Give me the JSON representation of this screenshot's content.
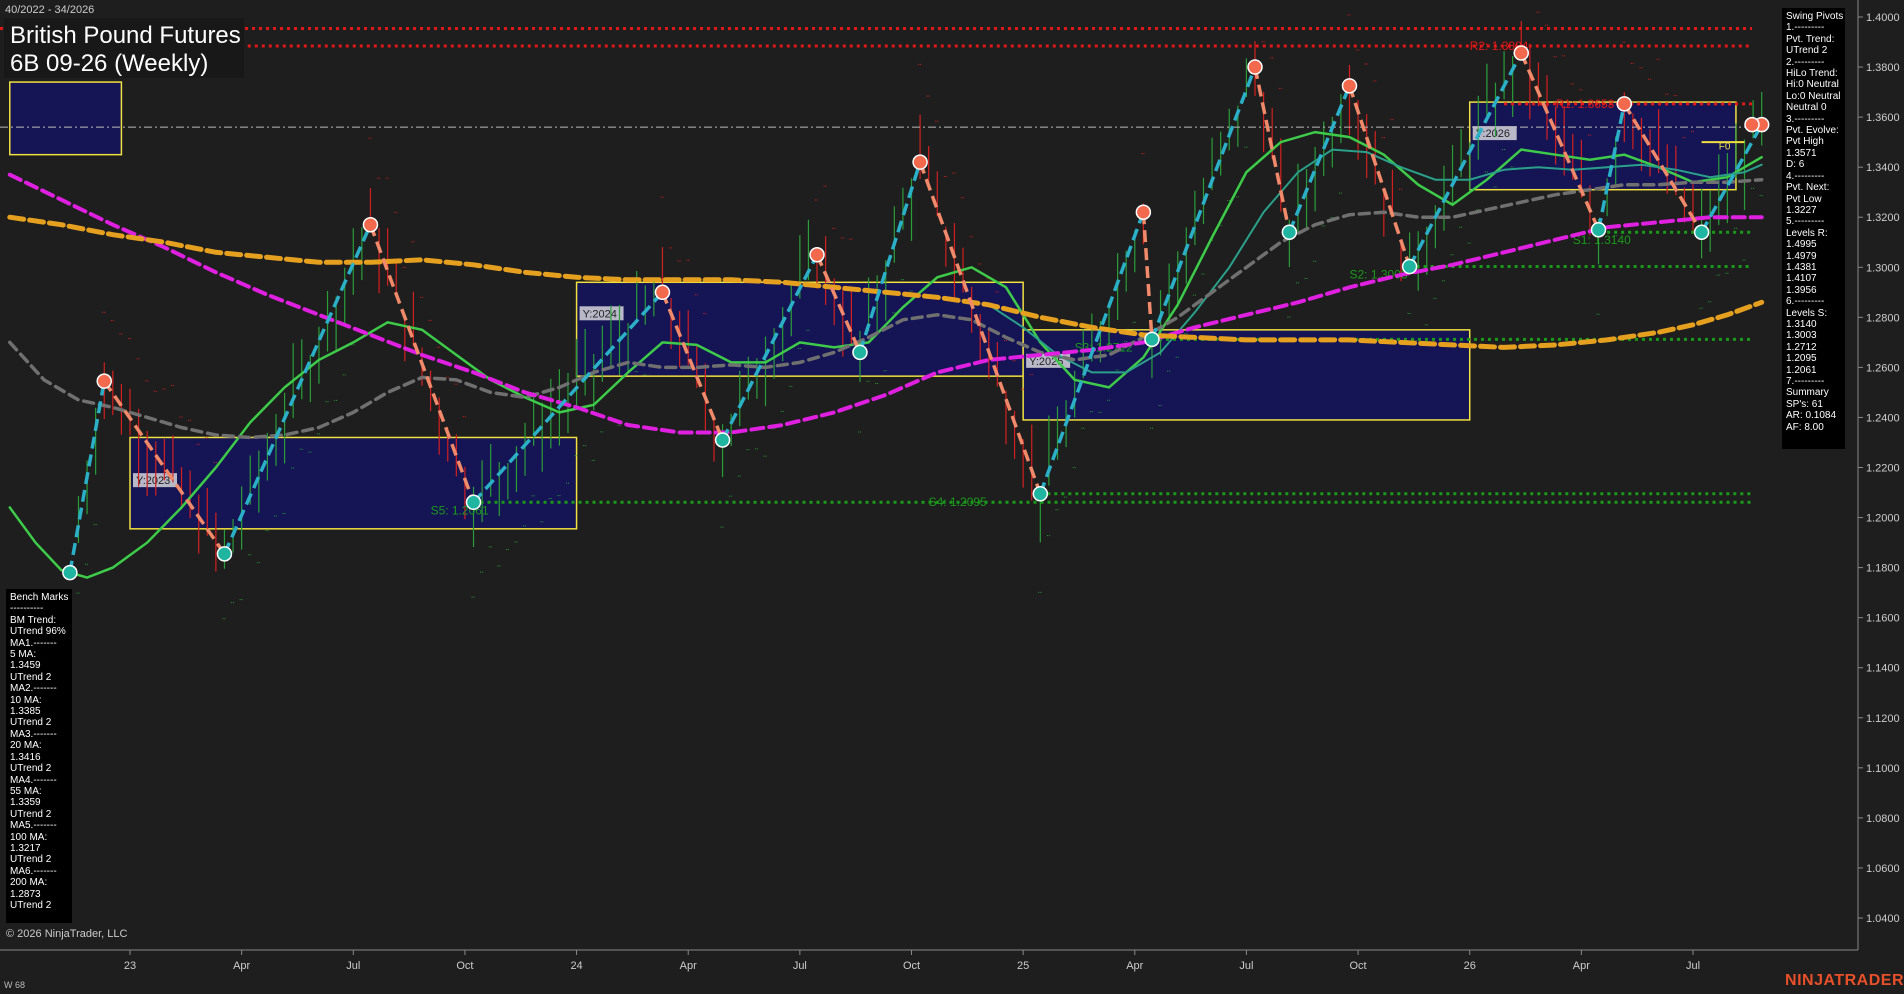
{
  "header": {
    "range": "40/2022 - 34/2026",
    "title": "British Pound Futures",
    "subtitle": "6B 09-26 (Weekly)"
  },
  "footer": {
    "copyright": "© 2026 NinjaTrader, LLC",
    "w_label": "W 68",
    "brand": "NINJATRADER"
  },
  "swing_pivots_panel": [
    "Swing Pivots",
    "1.---------",
    "Pvt. Trend:",
    "UTrend 2",
    "2.---------",
    "HiLo Trend:",
    "Hi:0 Neutral",
    "Lo:0 Neutral",
    "Neutral 0",
    "3.---------",
    "Pvt. Evolve:",
    "Pvt High",
    "1.3571",
    "D: 6",
    "4.---------",
    "Pvt. Next:",
    "Pvt Low",
    "1.3227",
    "5.---------",
    "Levels R:",
    "1.4995",
    "1.4979",
    "1.4381",
    "1.4107",
    "1.3956",
    "6.---------",
    "Levels S:",
    "1.3140",
    "1.3003",
    "1.2712",
    "1.2095",
    "1.2061",
    "7.---------",
    "Summary",
    "SP's: 61",
    "AR: 0.1084",
    "AF: 8.00"
  ],
  "bench_marks_panel": [
    "Bench Marks",
    "----------",
    "BM Trend:",
    "UTrend 96%",
    "MA1.-------",
    "5 MA:",
    "1.3459",
    "UTrend 2",
    "MA2.-------",
    "10 MA:",
    "1.3385",
    "UTrend 2",
    "MA3.-------",
    "20 MA:",
    "1.3416",
    "UTrend 2",
    "MA4.-------",
    "55 MA:",
    "1.3359",
    "UTrend 2",
    "MA5.-------",
    "100 MA:",
    "1.3217",
    "UTrend 2",
    "MA6.-------",
    "200 MA:",
    "1.2873",
    "UTrend 2"
  ],
  "chart_data": {
    "type": "line",
    "ylim": [
      1.03,
      1.405
    ],
    "y_ticks": [
      "1.4000",
      "1.3800",
      "1.3600",
      "1.3400",
      "1.3200",
      "1.3000",
      "1.2800",
      "1.2600",
      "1.2400",
      "1.2200",
      "1.2000",
      "1.1800",
      "1.1600",
      "1.1400",
      "1.1200",
      "1.1000",
      "1.0800",
      "1.0600",
      "1.0400"
    ],
    "x_ticks": [
      "23",
      "Apr",
      "Jul",
      "Oct",
      "24",
      "Apr",
      "Jul",
      "Oct",
      "25",
      "Apr",
      "Jul",
      "Oct",
      "26",
      "Apr",
      "Jul"
    ],
    "x_tick_index": [
      0,
      13,
      26,
      39,
      52,
      65,
      78,
      91,
      104,
      117,
      130,
      143,
      156,
      169,
      182
    ],
    "x_range_index": [
      -14,
      198
    ],
    "colors": {
      "up": "#2a9d3a",
      "down": "#d22020",
      "pivot_up": "#2bb0c8",
      "pivot_down": "#f08a6a",
      "ma_green": "#3ecb4a",
      "ma_teal": "#2aa08a",
      "ma_gray": "#707070",
      "ma_magenta": "#e020e0",
      "ma_orange": "#e6a020",
      "box_border": "#f0e040",
      "box_fill": "#15155a",
      "resistance": "#e01818",
      "support": "#1a9a1a"
    },
    "swing_pivots": [
      {
        "i": -7,
        "v": 1.178,
        "t": "L"
      },
      {
        "i": -3,
        "v": 1.2545,
        "t": "H"
      },
      {
        "i": 11,
        "v": 1.1855,
        "t": "L"
      },
      {
        "i": 28,
        "v": 1.317,
        "t": "H"
      },
      {
        "i": 40,
        "v": 1.2061,
        "t": "L"
      },
      {
        "i": 62,
        "v": 1.29,
        "t": "H"
      },
      {
        "i": 69,
        "v": 1.231,
        "t": "L"
      },
      {
        "i": 80,
        "v": 1.305,
        "t": "H"
      },
      {
        "i": 85,
        "v": 1.266,
        "t": "L"
      },
      {
        "i": 92,
        "v": 1.342,
        "t": "H"
      },
      {
        "i": 106,
        "v": 1.2095,
        "t": "L"
      },
      {
        "i": 118,
        "v": 1.322,
        "t": "H"
      },
      {
        "i": 119,
        "v": 1.2712,
        "t": "L"
      },
      {
        "i": 131,
        "v": 1.38,
        "t": "H"
      },
      {
        "i": 135,
        "v": 1.314,
        "t": "L"
      },
      {
        "i": 142,
        "v": 1.3725,
        "t": "H"
      },
      {
        "i": 149,
        "v": 1.3003,
        "t": "L"
      },
      {
        "i": 162,
        "v": 1.3856,
        "t": "H"
      },
      {
        "i": 171,
        "v": 1.315,
        "t": "L"
      },
      {
        "i": 174,
        "v": 1.3653,
        "t": "H"
      },
      {
        "i": 183,
        "v": 1.314,
        "t": "L"
      },
      {
        "i": 190,
        "v": 1.357,
        "t": "H"
      }
    ],
    "year_boxes": [
      {
        "label": "Y:2023",
        "i0": 0,
        "i1": 52,
        "hi": 1.232,
        "lo": 1.1955
      },
      {
        "label": "Y:2024",
        "i0": 52,
        "i1": 104,
        "hi": 1.294,
        "lo": 1.2565
      },
      {
        "label": "Y:2025",
        "i0": 104,
        "i1": 156,
        "hi": 1.275,
        "lo": 1.239
      },
      {
        "label": "Y:2026",
        "i0": 156,
        "i1": 187,
        "hi": 1.366,
        "lo": 1.331
      },
      {
        "label": "",
        "i0": -14,
        "i1": -1,
        "hi": 1.374,
        "lo": 1.345
      }
    ],
    "levels": [
      {
        "label": "R2: 1.3884",
        "v": 1.3884,
        "kind": "resistance",
        "i0": -14,
        "i_label": 156
      },
      {
        "label": "R1: 1.3653",
        "v": 1.3653,
        "kind": "resistance",
        "i0": 160,
        "i_label": 166
      },
      {
        "label": "S1: 1.3140",
        "v": 1.314,
        "kind": "support",
        "i0": 172,
        "i_label": 168
      },
      {
        "label": "S2: 1.3003",
        "v": 1.3003,
        "kind": "support",
        "i0": 149,
        "i_label": 142
      },
      {
        "label": "S3: 1.2712",
        "v": 1.2712,
        "kind": "support",
        "i0": 119,
        "i_label": 110
      },
      {
        "label": "S4: 1.2095",
        "v": 1.2095,
        "kind": "support",
        "i0": 106,
        "i_label": 93
      },
      {
        "label": "S5: 1.2061",
        "v": 1.2061,
        "kind": "support",
        "i0": 40,
        "i_label": 35
      }
    ],
    "extra_lines": [
      {
        "v": 1.3954,
        "kind": "resistance"
      },
      {
        "v": 1.356,
        "kind": "white_dashdot"
      }
    ],
    "moving_averages": [
      {
        "name": "MA1",
        "color": "ma_green",
        "width": 2.5,
        "dash": "",
        "points": [
          [
            -14,
            1.204
          ],
          [
            -11,
            1.19
          ],
          [
            -8,
            1.179
          ],
          [
            -5,
            1.176
          ],
          [
            -2,
            1.18
          ],
          [
            2,
            1.19
          ],
          [
            6,
            1.204
          ],
          [
            10,
            1.22
          ],
          [
            14,
            1.238
          ],
          [
            18,
            1.252
          ],
          [
            22,
            1.263
          ],
          [
            26,
            1.27
          ],
          [
            30,
            1.278
          ],
          [
            34,
            1.275
          ],
          [
            38,
            1.265
          ],
          [
            42,
            1.255
          ],
          [
            46,
            1.248
          ],
          [
            50,
            1.242
          ],
          [
            54,
            1.245
          ],
          [
            58,
            1.258
          ],
          [
            62,
            1.27
          ],
          [
            66,
            1.269
          ],
          [
            70,
            1.262
          ],
          [
            74,
            1.262
          ],
          [
            78,
            1.27
          ],
          [
            82,
            1.268
          ],
          [
            86,
            1.27
          ],
          [
            90,
            1.284
          ],
          [
            94,
            1.296
          ],
          [
            98,
            1.3
          ],
          [
            102,
            1.292
          ],
          [
            106,
            1.27
          ],
          [
            110,
            1.255
          ],
          [
            114,
            1.252
          ],
          [
            118,
            1.264
          ],
          [
            122,
            1.285
          ],
          [
            126,
            1.312
          ],
          [
            130,
            1.338
          ],
          [
            134,
            1.35
          ],
          [
            138,
            1.354
          ],
          [
            142,
            1.352
          ],
          [
            146,
            1.345
          ],
          [
            150,
            1.333
          ],
          [
            154,
            1.325
          ],
          [
            158,
            1.335
          ],
          [
            162,
            1.347
          ],
          [
            166,
            1.345
          ],
          [
            170,
            1.343
          ],
          [
            174,
            1.345
          ],
          [
            178,
            1.34
          ],
          [
            182,
            1.334
          ],
          [
            186,
            1.336
          ],
          [
            190,
            1.344
          ]
        ]
      },
      {
        "name": "MA2",
        "color": "ma_teal",
        "width": 2,
        "dash": "",
        "points": [
          [
            100,
            1.285
          ],
          [
            104,
            1.276
          ],
          [
            108,
            1.265
          ],
          [
            112,
            1.258
          ],
          [
            116,
            1.258
          ],
          [
            120,
            1.266
          ],
          [
            124,
            1.282
          ],
          [
            128,
            1.3
          ],
          [
            132,
            1.322
          ],
          [
            136,
            1.338
          ],
          [
            140,
            1.347
          ],
          [
            144,
            1.346
          ],
          [
            148,
            1.34
          ],
          [
            152,
            1.335
          ],
          [
            156,
            1.335
          ],
          [
            160,
            1.339
          ],
          [
            164,
            1.34
          ],
          [
            168,
            1.339
          ],
          [
            172,
            1.34
          ],
          [
            176,
            1.341
          ],
          [
            180,
            1.339
          ],
          [
            184,
            1.336
          ],
          [
            188,
            1.338
          ],
          [
            190,
            1.341
          ]
        ]
      },
      {
        "name": "MA3",
        "color": "ma_gray",
        "width": 3.5,
        "dash": "10,6",
        "points": [
          [
            -14,
            1.27
          ],
          [
            -10,
            1.255
          ],
          [
            -6,
            1.247
          ],
          [
            -2,
            1.244
          ],
          [
            2,
            1.24
          ],
          [
            6,
            1.236
          ],
          [
            10,
            1.233
          ],
          [
            14,
            1.232
          ],
          [
            18,
            1.233
          ],
          [
            22,
            1.236
          ],
          [
            26,
            1.242
          ],
          [
            30,
            1.25
          ],
          [
            34,
            1.256
          ],
          [
            38,
            1.255
          ],
          [
            42,
            1.25
          ],
          [
            46,
            1.248
          ],
          [
            50,
            1.252
          ],
          [
            54,
            1.258
          ],
          [
            58,
            1.262
          ],
          [
            62,
            1.26
          ],
          [
            66,
            1.26
          ],
          [
            70,
            1.261
          ],
          [
            74,
            1.26
          ],
          [
            78,
            1.262
          ],
          [
            82,
            1.266
          ],
          [
            86,
            1.272
          ],
          [
            90,
            1.279
          ],
          [
            94,
            1.281
          ],
          [
            98,
            1.279
          ],
          [
            102,
            1.272
          ],
          [
            106,
            1.266
          ],
          [
            110,
            1.263
          ],
          [
            114,
            1.265
          ],
          [
            118,
            1.272
          ],
          [
            122,
            1.28
          ],
          [
            126,
            1.29
          ],
          [
            130,
            1.3
          ],
          [
            134,
            1.31
          ],
          [
            138,
            1.317
          ],
          [
            142,
            1.321
          ],
          [
            146,
            1.322
          ],
          [
            150,
            1.32
          ],
          [
            154,
            1.32
          ],
          [
            158,
            1.323
          ],
          [
            162,
            1.326
          ],
          [
            166,
            1.329
          ],
          [
            170,
            1.331
          ],
          [
            174,
            1.333
          ],
          [
            178,
            1.333
          ],
          [
            182,
            1.334
          ],
          [
            186,
            1.334
          ],
          [
            190,
            1.335
          ]
        ]
      },
      {
        "name": "MA4",
        "color": "ma_magenta",
        "width": 4,
        "dash": "12,6",
        "points": [
          [
            -14,
            1.337
          ],
          [
            -8,
            1.327
          ],
          [
            -2,
            1.317
          ],
          [
            4,
            1.308
          ],
          [
            10,
            1.298
          ],
          [
            16,
            1.289
          ],
          [
            22,
            1.281
          ],
          [
            28,
            1.273
          ],
          [
            34,
            1.265
          ],
          [
            40,
            1.258
          ],
          [
            46,
            1.25
          ],
          [
            52,
            1.244
          ],
          [
            58,
            1.237
          ],
          [
            64,
            1.234
          ],
          [
            70,
            1.234
          ],
          [
            76,
            1.237
          ],
          [
            82,
            1.242
          ],
          [
            88,
            1.249
          ],
          [
            94,
            1.258
          ],
          [
            100,
            1.263
          ],
          [
            106,
            1.265
          ],
          [
            112,
            1.267
          ],
          [
            118,
            1.27
          ],
          [
            124,
            1.276
          ],
          [
            130,
            1.281
          ],
          [
            136,
            1.286
          ],
          [
            142,
            1.292
          ],
          [
            148,
            1.297
          ],
          [
            154,
            1.301
          ],
          [
            160,
            1.306
          ],
          [
            166,
            1.311
          ],
          [
            172,
            1.316
          ],
          [
            178,
            1.318
          ],
          [
            184,
            1.32
          ],
          [
            190,
            1.32
          ]
        ]
      },
      {
        "name": "MA5",
        "color": "ma_orange",
        "width": 5,
        "dash": "14,6",
        "points": [
          [
            -14,
            1.32
          ],
          [
            -8,
            1.317
          ],
          [
            -2,
            1.313
          ],
          [
            4,
            1.31
          ],
          [
            10,
            1.306
          ],
          [
            16,
            1.304
          ],
          [
            22,
            1.302
          ],
          [
            28,
            1.302
          ],
          [
            34,
            1.303
          ],
          [
            40,
            1.301
          ],
          [
            46,
            1.298
          ],
          [
            52,
            1.296
          ],
          [
            58,
            1.295
          ],
          [
            64,
            1.295
          ],
          [
            70,
            1.295
          ],
          [
            76,
            1.294
          ],
          [
            82,
            1.292
          ],
          [
            88,
            1.29
          ],
          [
            94,
            1.288
          ],
          [
            100,
            1.285
          ],
          [
            106,
            1.28
          ],
          [
            112,
            1.276
          ],
          [
            118,
            1.273
          ],
          [
            124,
            1.272
          ],
          [
            130,
            1.271
          ],
          [
            136,
            1.271
          ],
          [
            142,
            1.271
          ],
          [
            148,
            1.27
          ],
          [
            154,
            1.269
          ],
          [
            160,
            1.268
          ],
          [
            166,
            1.269
          ],
          [
            172,
            1.271
          ],
          [
            178,
            1.274
          ],
          [
            182,
            1.277
          ],
          [
            186,
            1.281
          ],
          [
            190,
            1.286
          ]
        ]
      }
    ],
    "r_markers_note": "Orange circles mark swing highs, teal circles mark swing lows",
    "fo_label": "F0"
  }
}
